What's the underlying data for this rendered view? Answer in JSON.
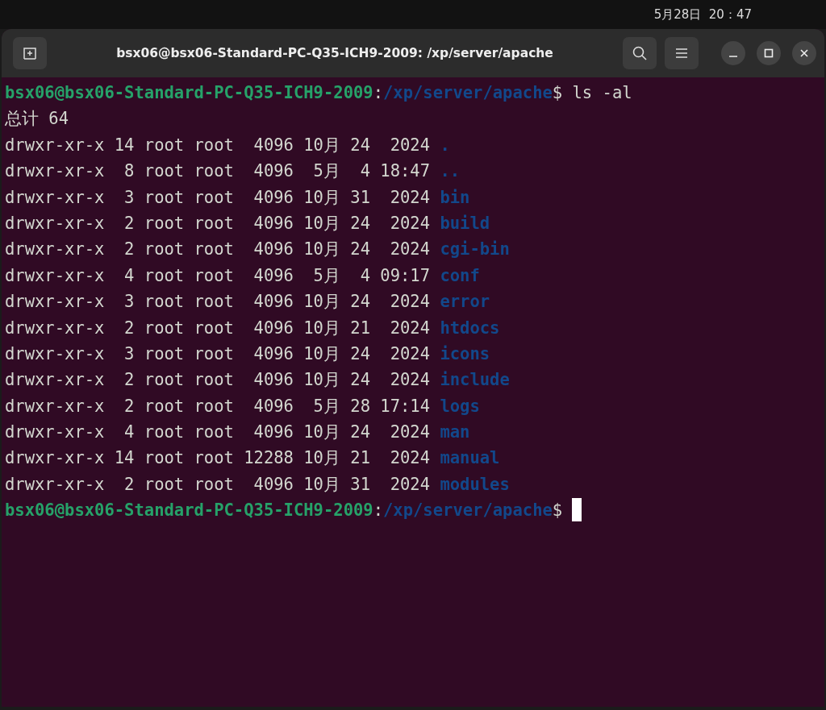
{
  "top_bar": {
    "clock": "5月28日  20：47"
  },
  "window": {
    "title": "bsx06@bsx06-Standard-PC-Q35-ICH9-2009: /xp/server/apache"
  },
  "terminal": {
    "lines": [
      {
        "kind": "prompt",
        "user_host": "bsx06@bsx06-Standard-PC-Q35-ICH9-2009",
        "separator": ":",
        "path": "/xp/server/apache",
        "symbol": "$",
        "command": " ls -al"
      },
      {
        "kind": "text",
        "text": "总计 64"
      },
      {
        "kind": "entry",
        "meta": "drwxr-xr-x 14 root root  4096 10月 24  2024 ",
        "name": "."
      },
      {
        "kind": "entry",
        "meta": "drwxr-xr-x  8 root root  4096  5月  4 18:47 ",
        "name": ".."
      },
      {
        "kind": "entry",
        "meta": "drwxr-xr-x  3 root root  4096 10月 31  2024 ",
        "name": "bin"
      },
      {
        "kind": "entry",
        "meta": "drwxr-xr-x  2 root root  4096 10月 24  2024 ",
        "name": "build"
      },
      {
        "kind": "entry",
        "meta": "drwxr-xr-x  2 root root  4096 10月 24  2024 ",
        "name": "cgi-bin"
      },
      {
        "kind": "entry",
        "meta": "drwxr-xr-x  4 root root  4096  5月  4 09:17 ",
        "name": "conf"
      },
      {
        "kind": "entry",
        "meta": "drwxr-xr-x  3 root root  4096 10月 24  2024 ",
        "name": "error"
      },
      {
        "kind": "entry",
        "meta": "drwxr-xr-x  2 root root  4096 10月 21  2024 ",
        "name": "htdocs"
      },
      {
        "kind": "entry",
        "meta": "drwxr-xr-x  3 root root  4096 10月 24  2024 ",
        "name": "icons"
      },
      {
        "kind": "entry",
        "meta": "drwxr-xr-x  2 root root  4096 10月 24  2024 ",
        "name": "include"
      },
      {
        "kind": "entry",
        "meta": "drwxr-xr-x  2 root root  4096  5月 28 17:14 ",
        "name": "logs"
      },
      {
        "kind": "entry",
        "meta": "drwxr-xr-x  4 root root  4096 10月 24  2024 ",
        "name": "man"
      },
      {
        "kind": "entry",
        "meta": "drwxr-xr-x 14 root root 12288 10月 21  2024 ",
        "name": "manual"
      },
      {
        "kind": "entry",
        "meta": "drwxr-xr-x  2 root root  4096 10月 31  2024 ",
        "name": "modules"
      },
      {
        "kind": "prompt",
        "user_host": "bsx06@bsx06-Standard-PC-Q35-ICH9-2009",
        "separator": ":",
        "path": "/xp/server/apache",
        "symbol": "$",
        "cursor": true
      }
    ]
  }
}
